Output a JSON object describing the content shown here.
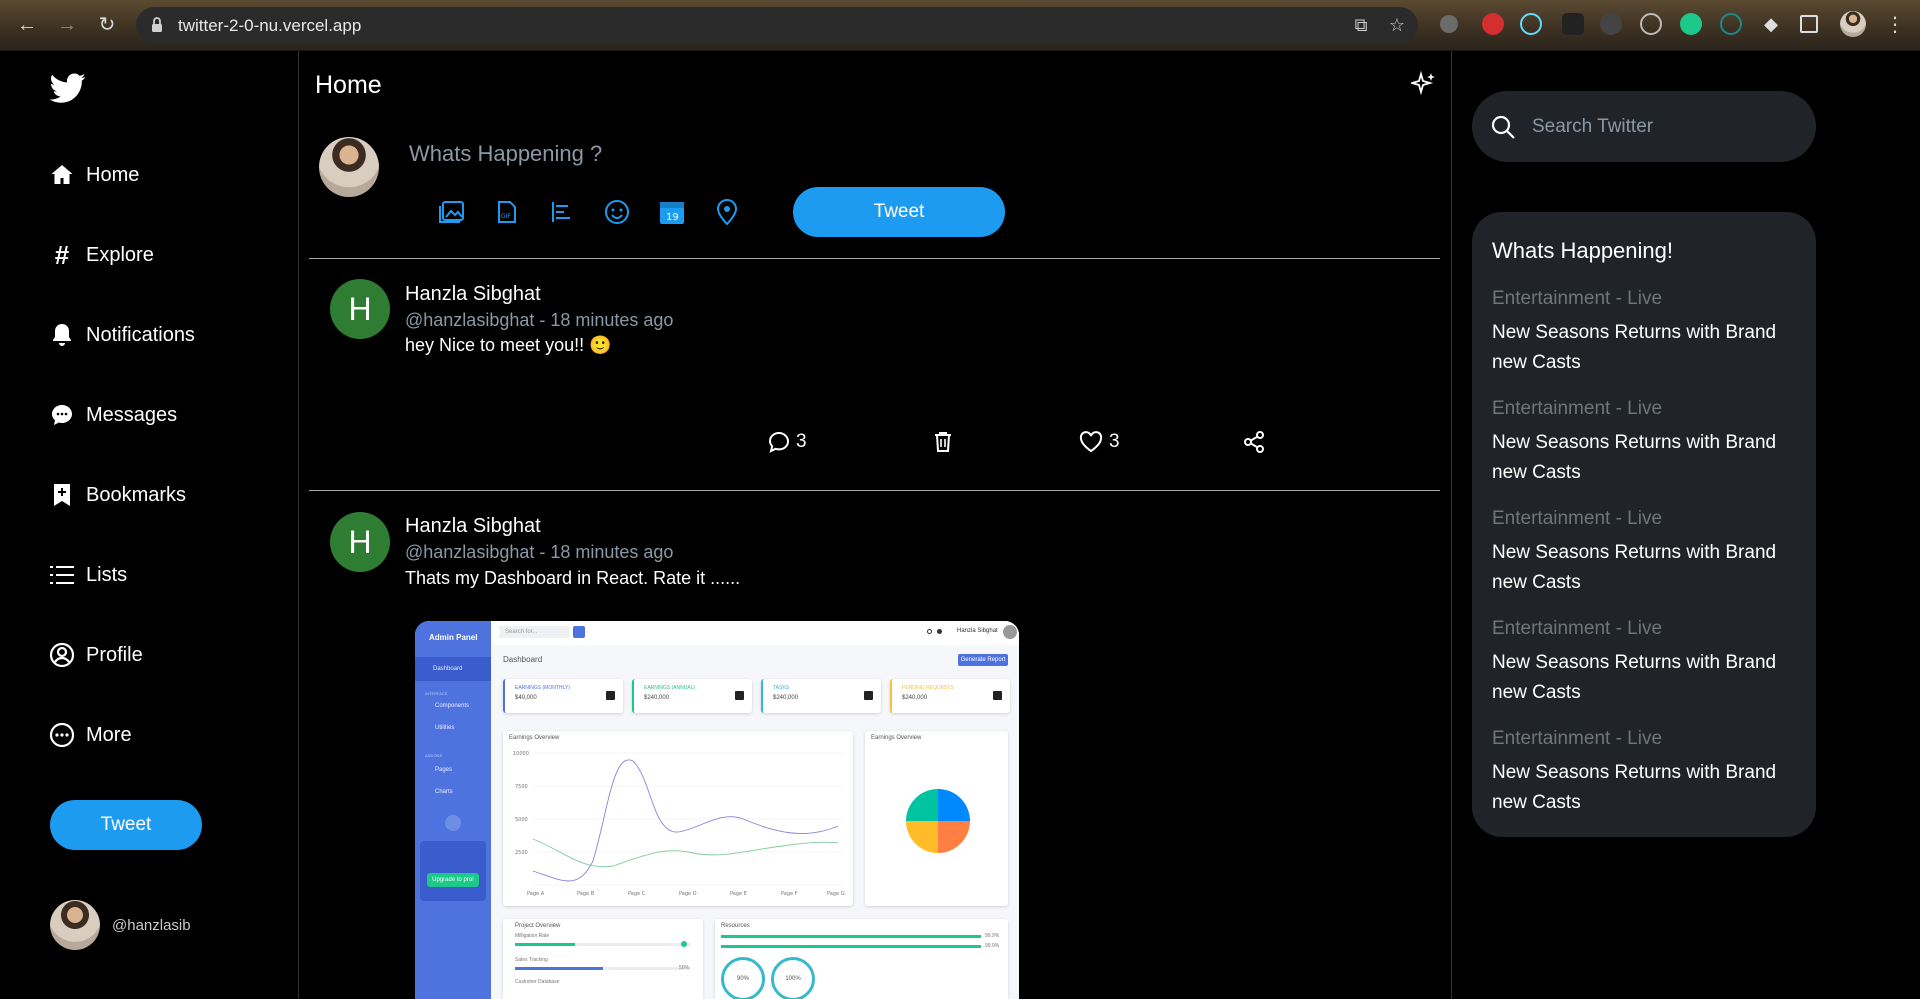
{
  "browser": {
    "url": "twitter-2-0-nu.vercel.app"
  },
  "sidebar": {
    "items": [
      {
        "label": "Home",
        "icon": "home-icon"
      },
      {
        "label": "Explore",
        "icon": "hashtag-icon"
      },
      {
        "label": "Notifications",
        "icon": "bell-icon"
      },
      {
        "label": "Messages",
        "icon": "chat-bubble-icon"
      },
      {
        "label": "Bookmarks",
        "icon": "bookmark-icon"
      },
      {
        "label": "Lists",
        "icon": "list-icon"
      },
      {
        "label": "Profile",
        "icon": "user-circle-icon"
      },
      {
        "label": "More",
        "icon": "more-circle-icon"
      }
    ],
    "tweet_label": "Tweet",
    "user_handle": "@hanzlasib"
  },
  "feed": {
    "title": "Home",
    "compose_placeholder": "Whats Happening ?",
    "compose_tweet_label": "Tweet",
    "posts": [
      {
        "initial": "H",
        "name": "Hanzla Sibghat",
        "meta": "@hanzlasibghat - 18 minutes ago",
        "text": "hey Nice to meet you!!",
        "emoji": "🙂",
        "comments": "3",
        "likes": "3"
      },
      {
        "initial": "H",
        "name": "Hanzla Sibghat",
        "meta": "@hanzlasibghat - 18 minutes ago",
        "text": "Thats my Dashboard in React. Rate it ......"
      }
    ]
  },
  "dashboard_image": {
    "brand": "Admin Panel",
    "nav": [
      "Dashboard",
      "INTERFACE",
      "Components",
      "Utilities",
      "ADDONS",
      "Pages",
      "Charts"
    ],
    "upgrade": "Upgrade to pro!",
    "search_placeholder": "Search for...",
    "user": "Hanzla Sibghat",
    "heading": "Dashboard",
    "generate": "Generate Report",
    "cards": [
      {
        "title": "EARNINGS (MONTHLY)",
        "value": "$40,000",
        "color": "#4e73df"
      },
      {
        "title": "EARNINGS (ANNUAL)",
        "value": "$240,000",
        "color": "#1cc88a"
      },
      {
        "title": "TASKS",
        "value": "$240,000",
        "color": "#36b9cc"
      },
      {
        "title": "PENDING REQUESTS",
        "value": "$240,000",
        "color": "#f6c23e"
      }
    ],
    "earnings_title": "Earnings Overview",
    "pie_title": "Earnings Overview",
    "project_title": "Project Overview",
    "resources_title": "Resources",
    "project_rows": [
      "Milligation Rate",
      "Sales Tracking",
      "Customer Database"
    ],
    "project_pct": "50%",
    "resource_pct": [
      "99.9%",
      "99.9%"
    ],
    "rings": [
      "90%",
      "100%"
    ],
    "y_ticks": [
      "10000",
      "7500",
      "5000",
      "2500"
    ],
    "x_ticks": [
      "Page A",
      "Page B",
      "Page C",
      "Page D",
      "Page E",
      "Page F",
      "Page G"
    ]
  },
  "right": {
    "search_placeholder": "Search Twitter",
    "trends_title": "Whats Happening!",
    "trends": [
      {
        "category": "Entertainment - Live",
        "title": "New Seasons Returns with Brand new Casts"
      },
      {
        "category": "Entertainment - Live",
        "title": "New Seasons Returns with Brand new Casts"
      },
      {
        "category": "Entertainment - Live",
        "title": "New Seasons Returns with Brand new Casts"
      },
      {
        "category": "Entertainment - Live",
        "title": "New Seasons Returns with Brand new Casts"
      },
      {
        "category": "Entertainment - Live",
        "title": "New Seasons Returns with Brand new Casts"
      }
    ]
  },
  "colors": {
    "accent": "#1d9bf0",
    "post_avatar": "#2e7d32",
    "panel_bg": "#202327",
    "muted": "#8b98a5"
  }
}
